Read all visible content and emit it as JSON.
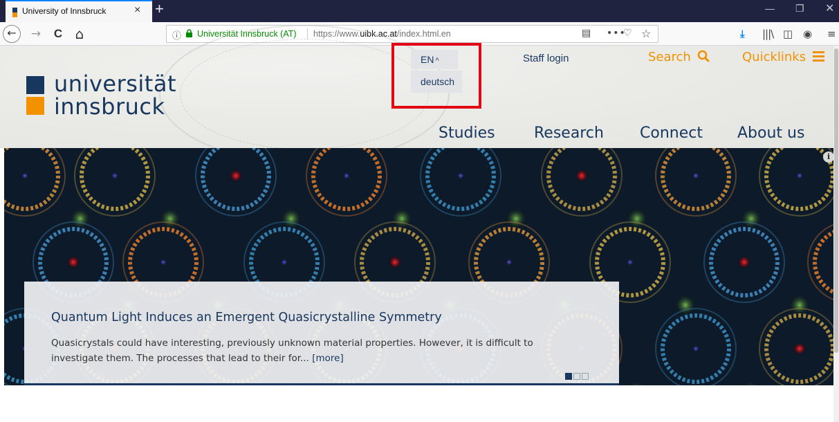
{
  "browser": {
    "tab_title": "University of Innsbruck",
    "tab_close": "×",
    "new_tab": "+",
    "site_identity": "Universität Innsbruck (AT)",
    "url_prefix": "https://www.",
    "url_domain": "uibk.ac.at",
    "url_suffix": "/index.html.en",
    "icons": [
      "back-icon",
      "forward-icon",
      "reload-icon",
      "home-icon",
      "info-icon",
      "lock-icon",
      "reader-icon",
      "more-icon",
      "pocket-icon",
      "bookmark-star-icon",
      "download-icon",
      "library-icon",
      "sidebar-icon",
      "account-icon",
      "menu-icon",
      "minimize-icon",
      "restore-icon",
      "close-icon"
    ],
    "more_label": "•••",
    "back_label": "←",
    "forward_label": "→",
    "reload_label": "C",
    "home_label": "⌂"
  },
  "header": {
    "logo_line1": "universität",
    "logo_line2": "innsbruck",
    "language": {
      "current": "EN",
      "option": "deutsch"
    },
    "staff_login": "Staff login",
    "search_label": "Search",
    "quicklinks_label": "Quicklinks",
    "nav": [
      "Studies",
      "Research",
      "Connect",
      "About us"
    ],
    "colors": {
      "brand_blue": "#17375e",
      "brand_orange": "#f39200",
      "annotation_red": "#e30613"
    }
  },
  "hero": {
    "info_label": "i",
    "title": "Quantum Light Induces an Emergent Quasicrystalline Symmetry",
    "text": "Quasicrystals could have interesting, previously unknown material properties. However, it is difficult to investigate them. The processes that lead to their for...",
    "more": "[more]",
    "slides_total": 3,
    "slide_active": 1
  }
}
